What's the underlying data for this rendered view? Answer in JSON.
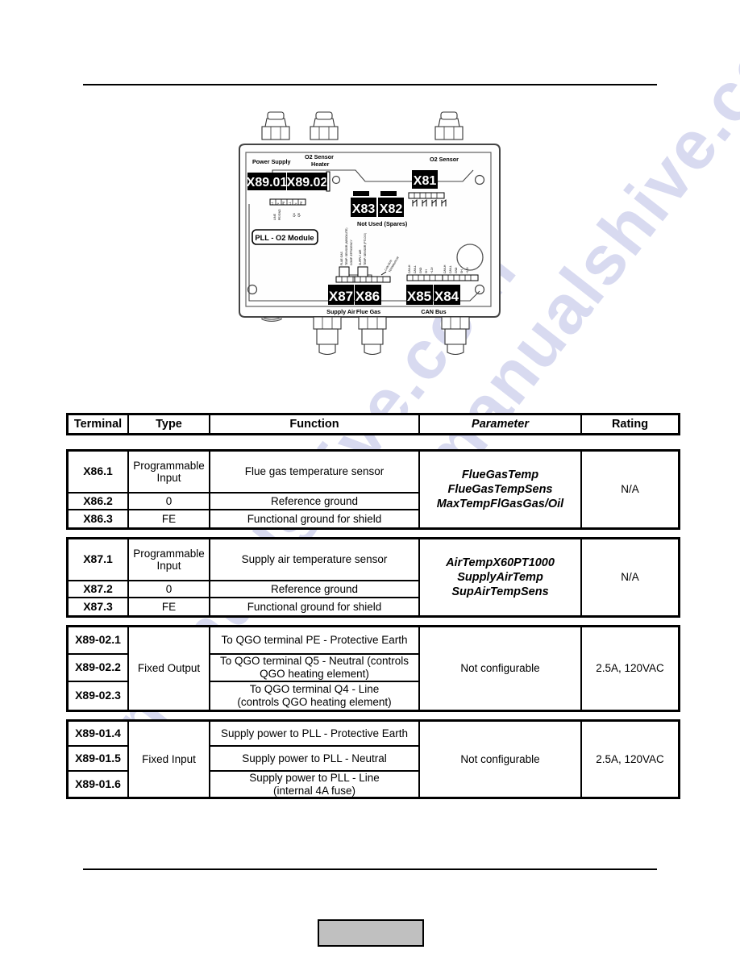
{
  "watermark": {
    "line1": "manualshive.com",
    "line2": "manualshive.com",
    "color": "#b9bde4"
  },
  "footer": {
    "page_box_label": ""
  },
  "diagram": {
    "module_label": "PLL - O2 Module",
    "labels": {
      "power_supply": "Power Supply",
      "o2_sensor_heater_line1": "O2 Sensor",
      "o2_sensor_heater_line2": "Heater",
      "o2_sensor": "O2 Sensor",
      "not_used_spares": "Not Used (Spares)",
      "supply_air": "Supply Air",
      "flue_gas": "Flue Gas",
      "can_bus": "CAN Bus"
    },
    "connectors": {
      "x89_01": "X89.01",
      "x89_02": "X89.02",
      "x81": "X81",
      "x83": "X83",
      "x82": "X82",
      "x87": "X87",
      "x86": "X86",
      "x85": "X85",
      "x84": "X84"
    }
  },
  "table": {
    "headers": {
      "terminal": "Terminal",
      "type": "Type",
      "function": "Function",
      "parameter": "Parameter",
      "rating": "Rating"
    },
    "blocks": [
      {
        "id": "x86",
        "terminals": [
          "X86.1",
          "X86.2",
          "X86.3"
        ],
        "types": [
          "Programmable Input",
          "0",
          "FE"
        ],
        "functions": [
          "Flue gas temperature sensor",
          "Reference ground",
          "Functional ground for shield"
        ],
        "parameter_lines": [
          "FlueGasTemp",
          "FlueGasTempSens",
          "MaxTempFlGasGas/Oil"
        ],
        "rating": "N/A"
      },
      {
        "id": "x87",
        "terminals": [
          "X87.1",
          "X87.2",
          "X87.3"
        ],
        "types": [
          "Programmable Input",
          "0",
          "FE"
        ],
        "functions": [
          "Supply air temperature sensor",
          "Reference ground",
          "Functional ground for shield"
        ],
        "parameter_lines": [
          "AirTempX60PT1000",
          "SupplyAirTemp",
          "SupAirTempSens"
        ],
        "rating": "N/A"
      },
      {
        "id": "x8902",
        "terminals": [
          "X89-02.1",
          "X89-02.2",
          "X89-02.3"
        ],
        "type_merged": "Fixed Output",
        "functions": [
          "To QGO terminal PE - Protective Earth",
          "To QGO terminal Q5 - Neutral (controls QGO heating element)",
          "To QGO terminal Q4 - Line (controls QGO heating element)"
        ],
        "function_line_a": [
          "To QGO terminal PE - Protective Earth",
          "To QGO terminal Q5 - Neutral (controls",
          "To QGO terminal Q4 - Line"
        ],
        "function_line_b": [
          "",
          "QGO heating element)",
          "(controls QGO heating element)"
        ],
        "parameter": "Not configurable",
        "rating": "2.5A, 120VAC"
      },
      {
        "id": "x8901",
        "terminals": [
          "X89-01.4",
          "X89-01.5",
          "X89-01.6"
        ],
        "type_merged": "Fixed Input",
        "functions": [
          "Supply power to PLL - Protective Earth",
          "Supply power to PLL - Neutral",
          "Supply power to PLL - Line (internal 4A fuse)"
        ],
        "function_line_a": [
          "Supply power to PLL - Protective Earth",
          "Supply power to PLL - Neutral",
          "Supply power to PLL - Line"
        ],
        "function_line_b": [
          "",
          "",
          "(internal 4A fuse)"
        ],
        "parameter": "Not configurable",
        "rating": "2.5A, 120VAC"
      }
    ]
  }
}
